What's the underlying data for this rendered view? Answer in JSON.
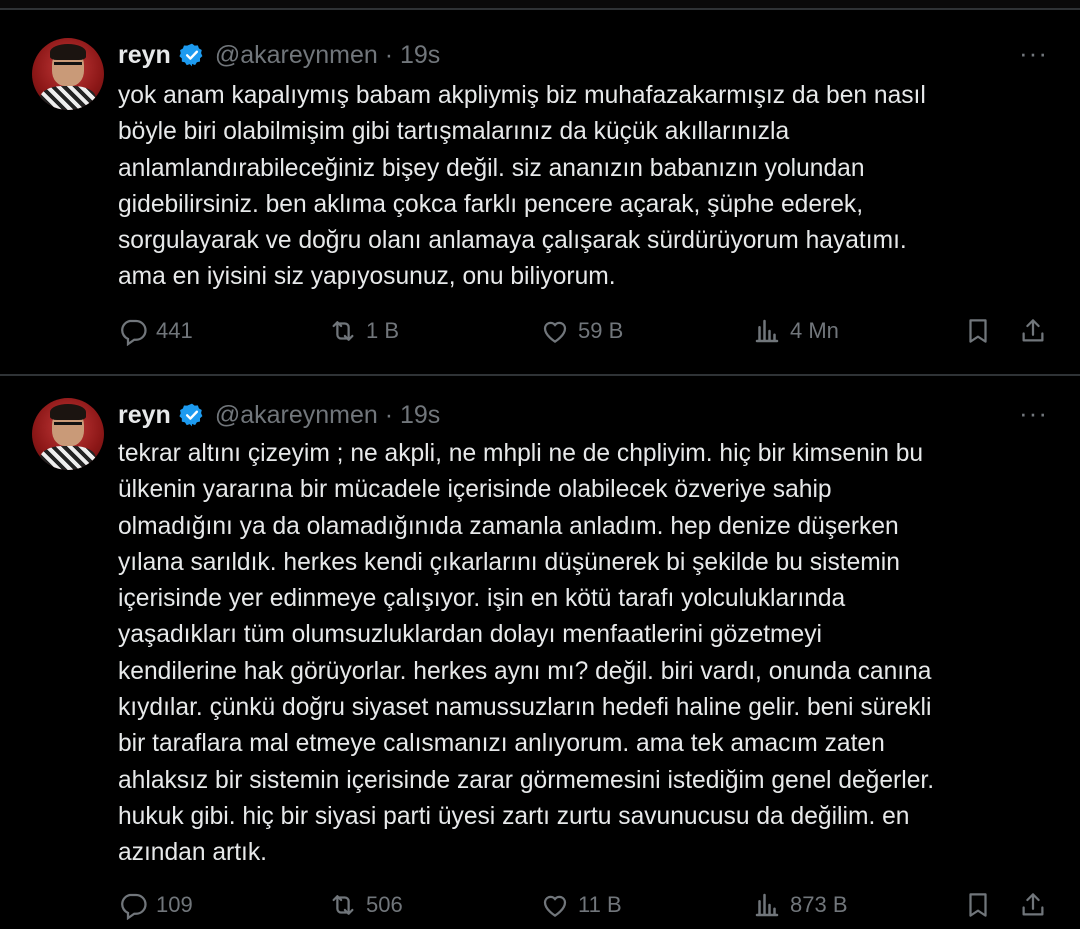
{
  "tweets": [
    {
      "name": "reyn",
      "handle_time": "@akareynmen · 19s",
      "more": "···",
      "lines": [
        "yok anam kapalıymış babam akpliymiş biz muhafazakarmışız da ben nasıl",
        "böyle biri olabilmişim gibi tartışmalarınız da küçük akıllarınızla",
        "anlamlandırabileceğiniz bişey değil. siz ananızın babanızın yolundan",
        "gidebilirsiniz. ben aklıma çokca farklı pencere açarak, şüphe ederek,",
        "sorgulayarak ve doğru olanı anlamaya çalışarak sürdürüyorum hayatımı.",
        "ama en iyisini siz yapıyosunuz, onu biliyorum."
      ],
      "replies": "441",
      "reposts": "1 B",
      "likes": "59 B",
      "views": "4 Mn"
    },
    {
      "name": "reyn",
      "handle_time": "@akareynmen · 19s",
      "more": "···",
      "lines": [
        "tekrar altını çizeyim ; ne akpli, ne mhpli ne de chpliyim. hiç bir kimsenin bu",
        "ülkenin yararına bir mücadele içerisinde olabilecek özveriye sahip",
        "olmadığını ya da olamadığınıda zamanla anladım. hep denize düşerken",
        "yılana sarıldık. herkes kendi çıkarlarını düşünerek bi şekilde bu sistemin",
        "içerisinde yer edinmeye çalışıyor. işin en kötü tarafı yolculuklarında",
        "yaşadıkları tüm olumsuzluklardan dolayı menfaatlerini gözetmeyi",
        "kendilerine hak görüyorlar. herkes aynı mı? değil. biri vardı, onunda canına",
        "kıydılar. çünkü doğru siyaset namussuzların hedefi haline gelir. beni sürekli",
        "bir taraflara mal etmeye calısmanızı anlıyorum. ama tek amacım zaten",
        "ahlaksız bir sistemin içerisinde zarar görmemesini istediğim genel değerler.",
        "hukuk gibi. hiç bir siyasi parti üyesi zartı zurtu savunucusu da değilim. en",
        "azından artık."
      ],
      "replies": "109",
      "reposts": "506",
      "likes": "11 B",
      "views": "873 B"
    }
  ],
  "colors": {
    "verified": "#1d9bf0",
    "muted": "#71767b",
    "text": "#e7e9ea",
    "divider": "#2f3336"
  },
  "icons": [
    "verified-badge-icon",
    "more-icon",
    "reply-icon",
    "repost-icon",
    "like-icon",
    "views-icon",
    "bookmark-icon",
    "share-icon"
  ]
}
